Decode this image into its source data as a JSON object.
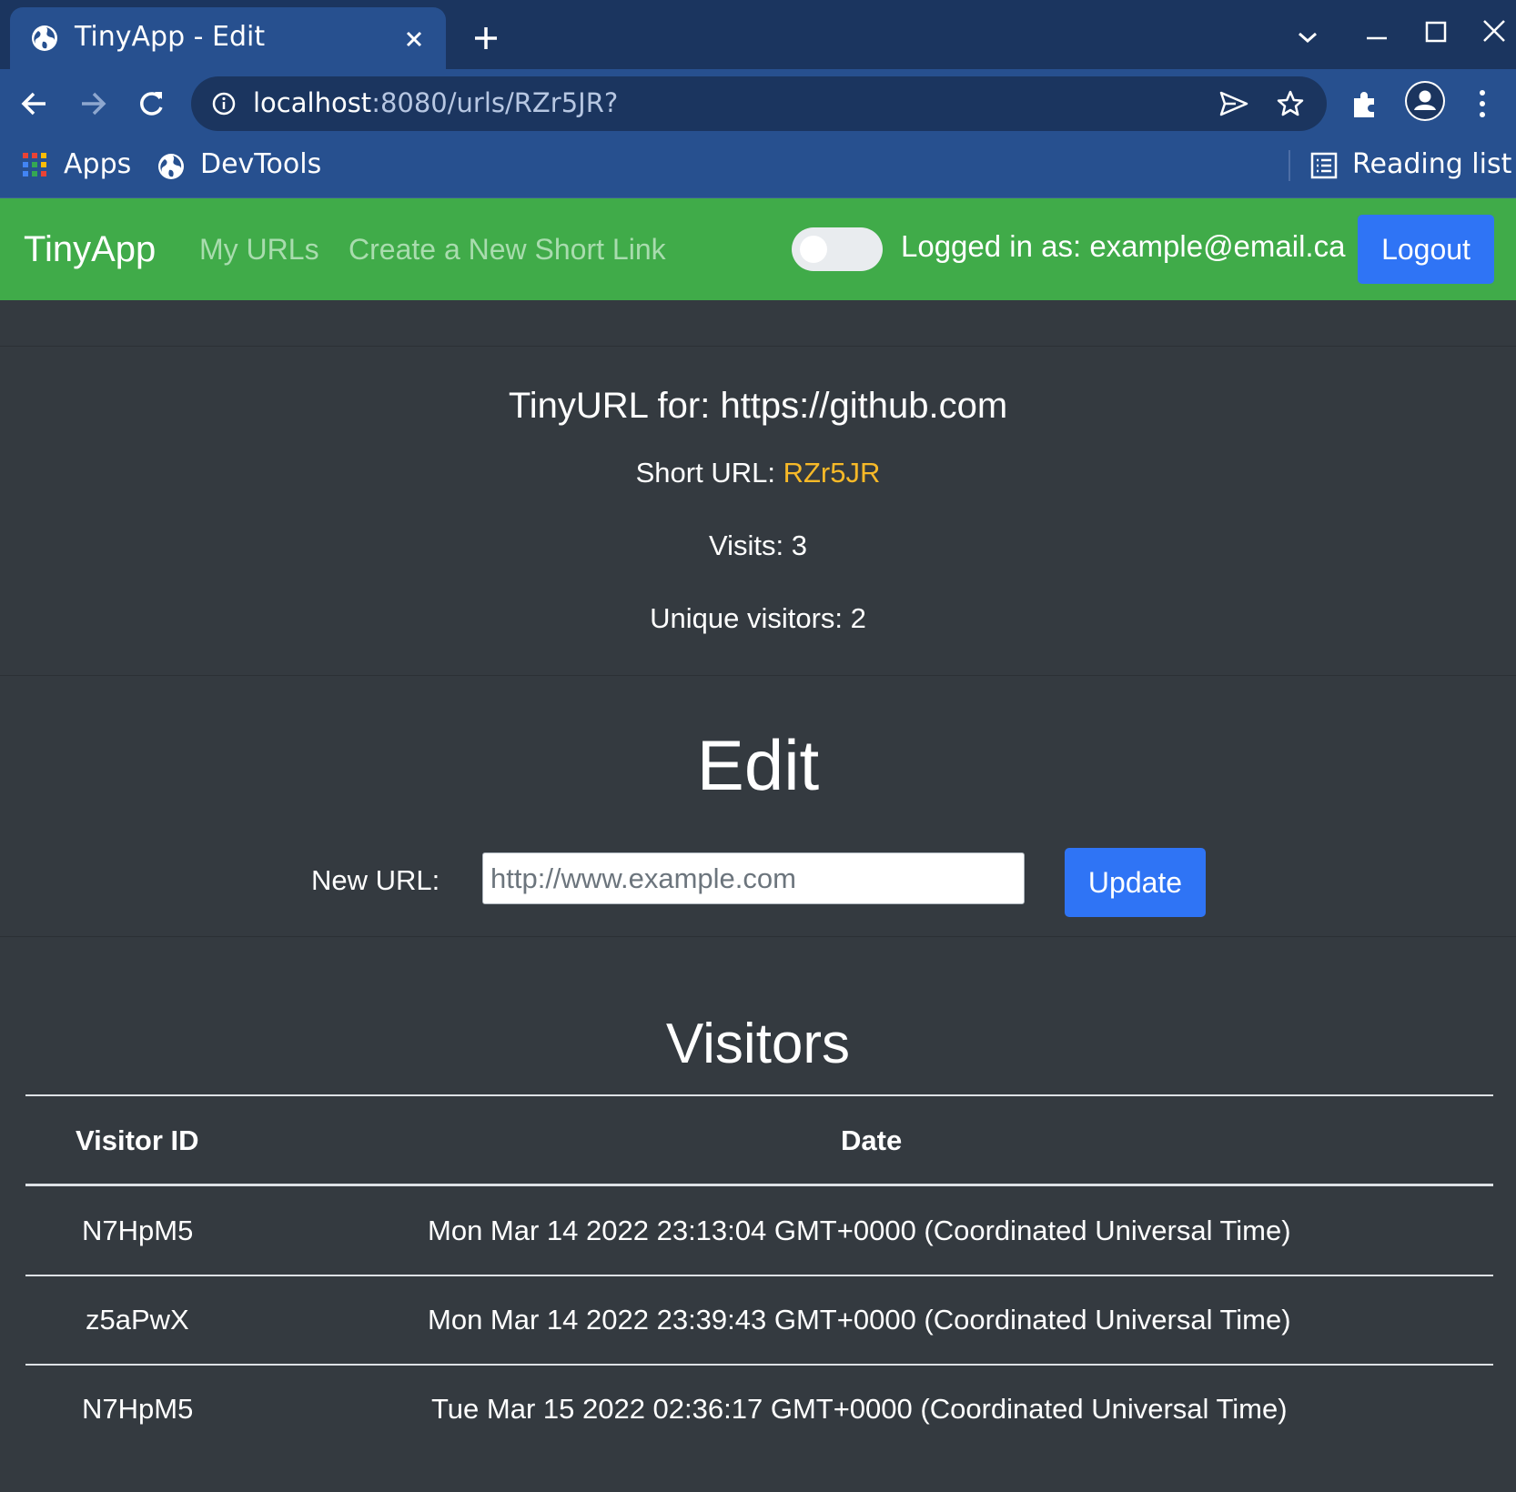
{
  "browser": {
    "tab_title": "TinyApp - Edit",
    "url_host": "localhost",
    "url_rest": ":8080/urls/RZr5JR?",
    "bookmarks": {
      "apps": "Apps",
      "devtools": "DevTools",
      "reading_list": "Reading list"
    }
  },
  "nav": {
    "brand": "TinyApp",
    "my_urls": "My URLs",
    "create_link": "Create a New Short Link",
    "logged_in": "Logged in as: example@email.ca",
    "logout": "Logout"
  },
  "url_info": {
    "title": "TinyURL for: https://github.com",
    "short_url_label": "Short URL: ",
    "short_url_code": "RZr5JR",
    "visits": "Visits: 3",
    "unique_visitors": "Unique visitors: 2"
  },
  "edit": {
    "heading": "Edit",
    "label": "New URL:",
    "placeholder": "http://www.example.com",
    "submit": "Update"
  },
  "visitors": {
    "heading": "Visitors",
    "columns": [
      "Visitor ID",
      "Date"
    ],
    "rows": [
      {
        "id": "N7HpM5",
        "date": "Mon Mar 14 2022 23:13:04 GMT+0000 (Coordinated Universal Time)"
      },
      {
        "id": "z5aPwX",
        "date": "Mon Mar 14 2022 23:39:43 GMT+0000 (Coordinated Universal Time)"
      },
      {
        "id": "N7HpM5",
        "date": "Tue Mar 15 2022 02:36:17 GMT+0000 (Coordinated Universal Time)"
      }
    ]
  },
  "colors": {
    "navbar": "#40ab49",
    "primary_button": "#2f74f5",
    "page_bg": "#343a40",
    "short_code": "#f7b928",
    "browser_frame": "#1b355f",
    "browser_toolbar": "#27508f"
  },
  "icons": [
    "globe-icon",
    "close-icon",
    "plus-icon",
    "chevron-down-icon",
    "minimize-icon",
    "maximize-icon",
    "window-close-icon",
    "back-icon",
    "forward-icon",
    "reload-icon",
    "info-icon",
    "send-icon",
    "star-icon",
    "extensions-icon",
    "profile-icon",
    "menu-icon",
    "apps-grid-icon",
    "reading-list-icon"
  ]
}
